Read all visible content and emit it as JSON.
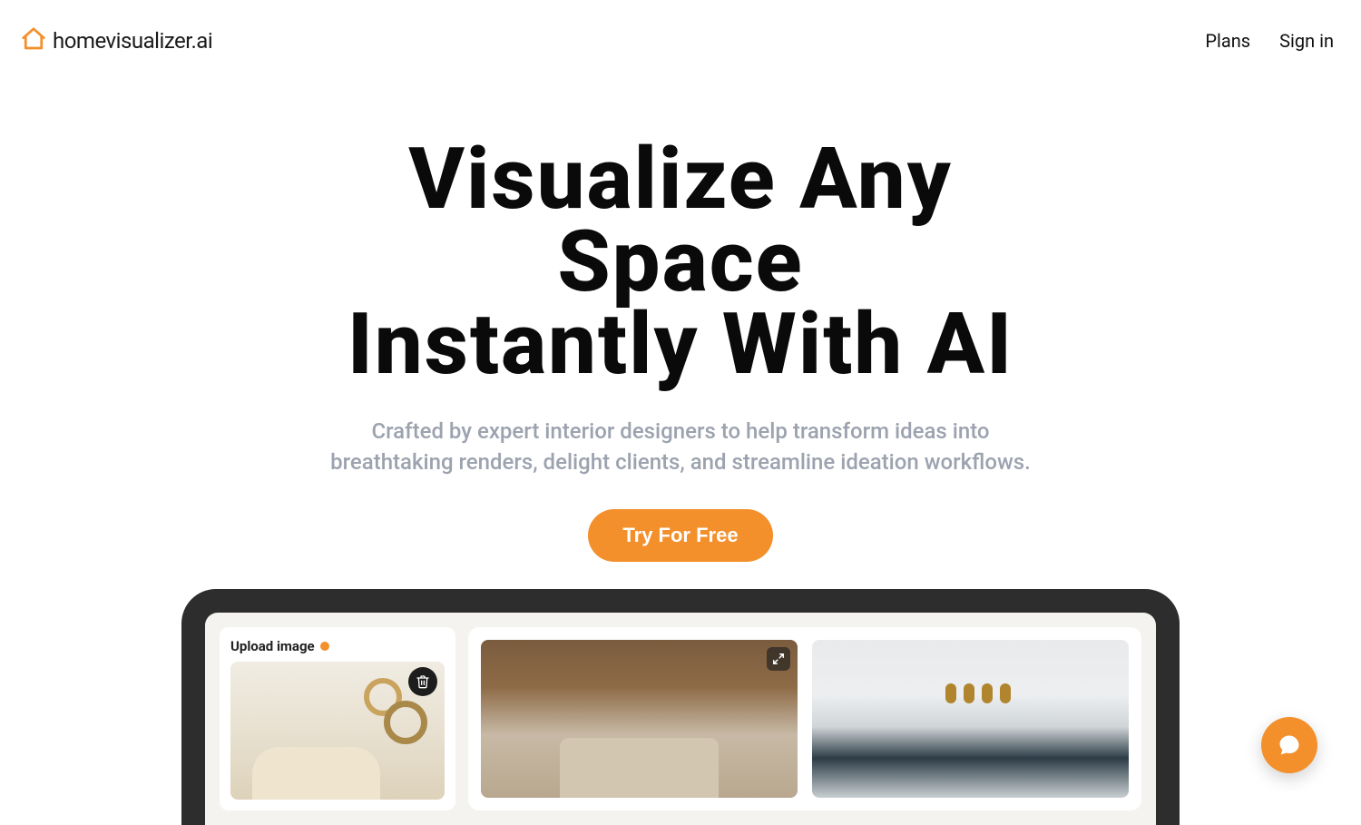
{
  "brand": {
    "name": "homevisualizer.ai",
    "accent": "#f3902b"
  },
  "nav": {
    "plans": "Plans",
    "signin": "Sign in"
  },
  "hero": {
    "line1": "Visualize Any",
    "line2": "Space",
    "line3": "Instantly With AI",
    "sub1": "Crafted by expert interior designers to help transform ideas into",
    "sub2": "breathtaking renders, delight clients, and streamline ideation workflows.",
    "cta": "Try For Free"
  },
  "app_preview": {
    "upload_label": "Upload image"
  }
}
